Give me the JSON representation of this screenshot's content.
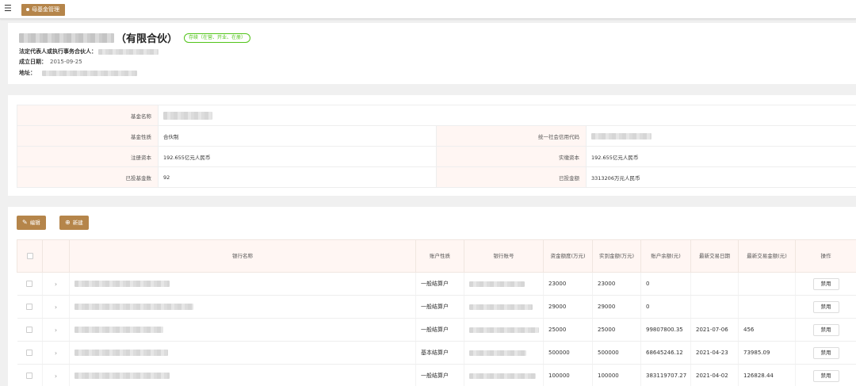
{
  "topbar": {
    "tab_label": "母基金管理"
  },
  "header": {
    "company_suffix": "（有限合伙）",
    "status": "存续（在营、开业、在册）",
    "legal_rep_label": "法定代表人或执行事务合伙人：",
    "established_label": "成立日期：",
    "established_value": "2015-09-25",
    "address_label": "地址："
  },
  "details": {
    "fund_name_label": "基金名称",
    "fund_nature_label": "基金性质",
    "fund_nature_value": "合伙制",
    "credit_code_label": "统一社会信用代码",
    "registered_capital_label": "注册资本",
    "registered_capital_value": "192.655亿元人民币",
    "paid_capital_label": "实缴资本",
    "paid_capital_value": "192.655亿元人民币",
    "invested_count_label": "已投基金数",
    "invested_count_value": "92",
    "invested_amount_label": "已投金额",
    "invested_amount_value": "3313206万元人民币"
  },
  "toolbar": {
    "edit_label": "编辑",
    "new_label": "新建"
  },
  "bank_table": {
    "headers": {
      "bank_name": "银行名称",
      "account_type": "账户性质",
      "account_no": "银行账号",
      "fund_quota": "资金额度(万元)",
      "actual_amount": "实到金额(万元)",
      "balance": "账户余额(元)",
      "last_trade_date": "最新交易日期",
      "last_trade_amount": "最新交易金额(元)",
      "actions": "操作"
    },
    "disable_label": "禁用",
    "rows": [
      {
        "account_type": "一般结算户",
        "fund_quota": "23000",
        "actual_amount": "23000",
        "balance": "0",
        "last_trade_date": "",
        "last_trade_amount": ""
      },
      {
        "account_type": "一般结算户",
        "fund_quota": "29000",
        "actual_amount": "29000",
        "balance": "0",
        "last_trade_date": "",
        "last_trade_amount": ""
      },
      {
        "account_type": "一般结算户",
        "fund_quota": "25000",
        "actual_amount": "25000",
        "balance": "99807800.35",
        "last_trade_date": "2021-07-06",
        "last_trade_amount": "456"
      },
      {
        "account_type": "基本结算户",
        "fund_quota": "500000",
        "actual_amount": "500000",
        "balance": "68645246.12",
        "last_trade_date": "2021-04-23",
        "last_trade_amount": "73985.09"
      },
      {
        "account_type": "一般结算户",
        "fund_quota": "100000",
        "actual_amount": "100000",
        "balance": "383119707.27",
        "last_trade_date": "2021-04-02",
        "last_trade_amount": "126828.44"
      }
    ]
  }
}
